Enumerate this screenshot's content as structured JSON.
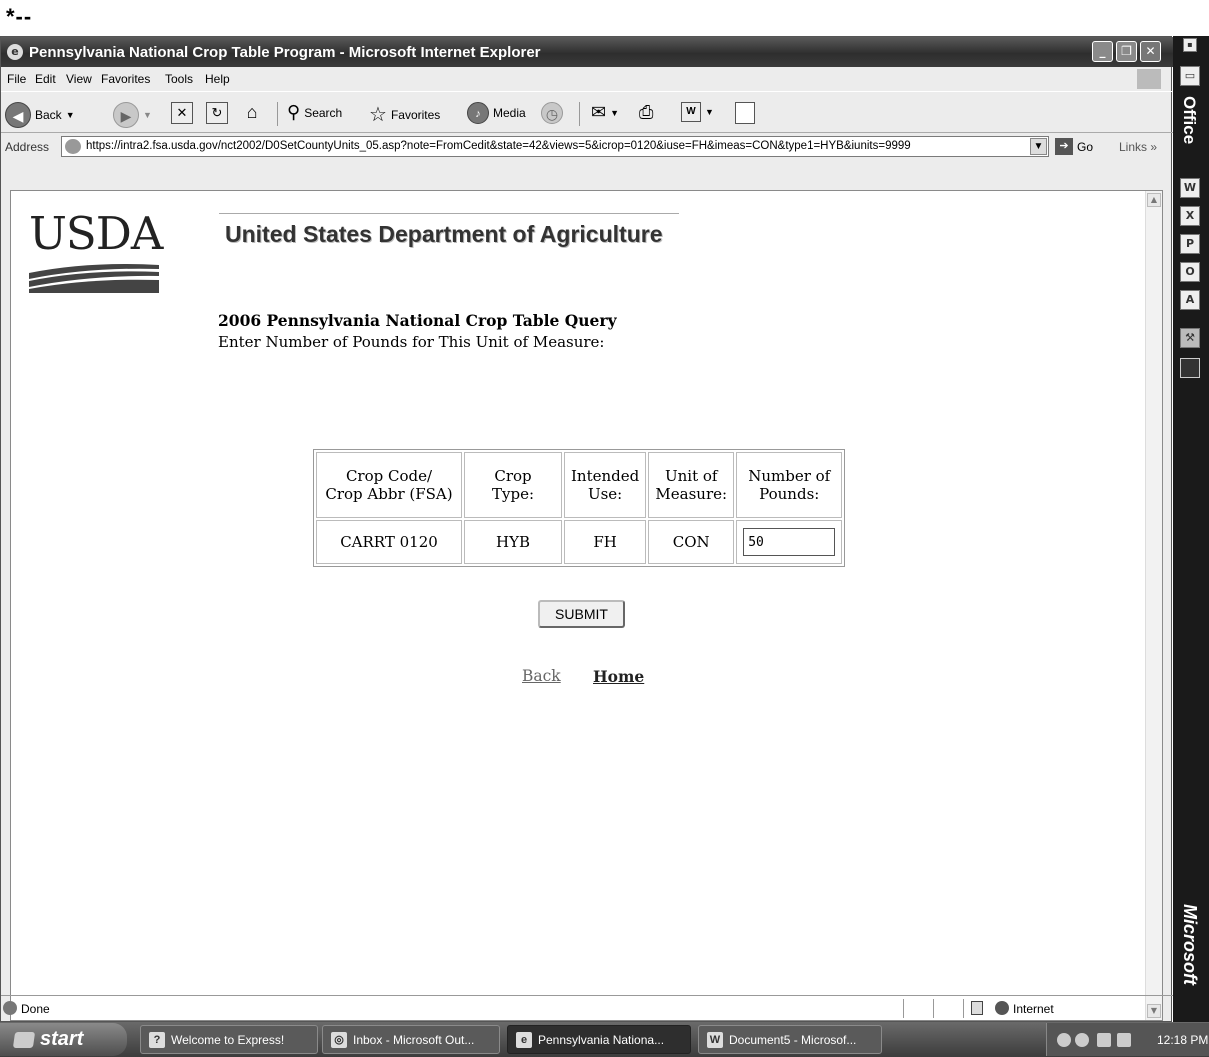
{
  "page_marker": "*--",
  "window": {
    "title": "Pennsylvania National Crop Table Program - Microsoft Internet Explorer"
  },
  "menu": [
    "File",
    "Edit",
    "View",
    "Favorites",
    "Tools",
    "Help"
  ],
  "toolbar": {
    "back_label": "Back",
    "search_label": "Search",
    "favorites_label": "Favorites",
    "media_label": "Media"
  },
  "address": {
    "label": "Address",
    "url": "https://intra2.fsa.usda.gov/nct2002/D0SetCountyUnits_05.asp?note=FromCedit&state=42&views=5&icrop=0120&iuse=FH&imeas=CON&type1=HYB&iunits=9999",
    "go_label": "Go",
    "links_label": "Links"
  },
  "page": {
    "logo_text": "USDA",
    "department": "United States Department of Agriculture",
    "query_title": "2006 Pennsylvania National Crop Table Query",
    "query_subtitle": "Enter Number of Pounds for This Unit of Measure:",
    "table": {
      "headers": [
        {
          "line1": "Crop Code/",
          "line2": "Crop Abbr (FSA)"
        },
        {
          "line1": "Crop Type:",
          "line2": ""
        },
        {
          "line1": "Intended",
          "line2": "Use:"
        },
        {
          "line1": "Unit of",
          "line2": "Measure:"
        },
        {
          "line1": "Number of",
          "line2": "Pounds:"
        }
      ],
      "row": {
        "crop_code": "CARRT 0120",
        "crop_type": "HYB",
        "intended_use": "FH",
        "unit_of_measure": "CON",
        "pounds_value": "50"
      }
    },
    "submit_label": "SUBMIT",
    "back_link": "Back",
    "home_link": "Home"
  },
  "status": {
    "text": "Done",
    "zone": "Internet"
  },
  "officebar": {
    "top_label": "Office",
    "bottom_label": "Microsoft"
  },
  "taskbar": {
    "start_label": "start",
    "tasks": [
      "Welcome to Express!",
      "Inbox - Microsoft Out...",
      "Pennsylvania Nationa...",
      "Document5 - Microsof..."
    ],
    "clock": "12:18 PM"
  },
  "icons": {
    "ie": "ie-icon",
    "back": "back-arrow-icon",
    "forward": "forward-arrow-icon",
    "stop": "stop-icon",
    "refresh": "refresh-icon",
    "home": "home-icon",
    "search": "search-icon",
    "favorites": "star-icon",
    "media": "media-icon",
    "history": "history-icon",
    "mail": "mail-icon",
    "print": "print-icon",
    "edit": "word-edit-icon",
    "discuss": "discuss-icon"
  }
}
